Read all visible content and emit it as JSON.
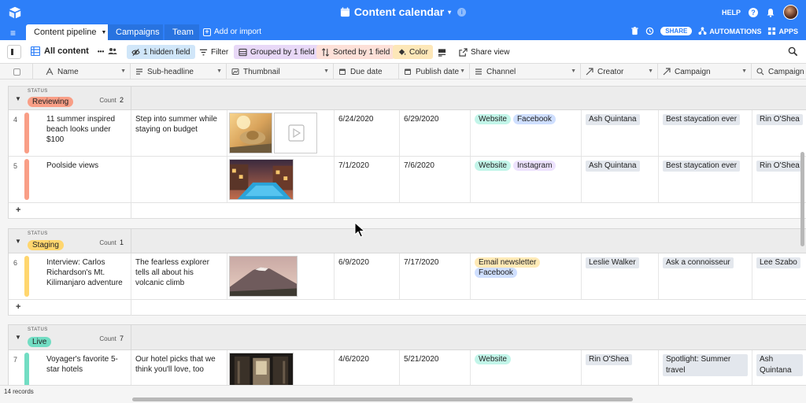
{
  "header": {
    "title": "Content calendar",
    "help": "HELP",
    "title_caret": "▾",
    "info": "i"
  },
  "tabs": [
    {
      "label": "Content pipeline",
      "active": true
    },
    {
      "label": "Campaigns"
    },
    {
      "label": "Team"
    }
  ],
  "tabs_extra": {
    "add_import": "Add or import",
    "share": "SHARE",
    "automations": "AUTOMATIONS",
    "apps": "APPS"
  },
  "toolbar": {
    "view_name": "All content",
    "more": "•••",
    "hidden_fields": "1 hidden field",
    "filter": "Filter",
    "grouped": "Grouped by 1 field",
    "sorted": "Sorted by 1 field",
    "color": "Color",
    "share_view": "Share view"
  },
  "columns": [
    {
      "label": "Name",
      "icon": "text-icon"
    },
    {
      "label": "Sub-headline",
      "icon": "paragraph-icon"
    },
    {
      "label": "Thumbnail",
      "icon": "attachment-icon"
    },
    {
      "label": "Due date",
      "icon": "calendar-icon"
    },
    {
      "label": "Publish date",
      "icon": "calendar-icon"
    },
    {
      "label": "Channel",
      "icon": "multi-select-icon"
    },
    {
      "label": "Creator",
      "icon": "link-icon"
    },
    {
      "label": "Campaign",
      "icon": "link-icon"
    },
    {
      "label": "Campaign lea",
      "icon": "lookup-icon"
    }
  ],
  "groups": [
    {
      "field": "STATUS",
      "value": "Reviewing",
      "color": "#f99e86",
      "count_label": "Count",
      "count": "2",
      "rows": [
        {
          "num": "4",
          "name": "11 summer inspired beach looks under $100",
          "sub": "Step into summer while staying on budget",
          "due": "6/24/2020",
          "publish": "6/29/2020",
          "channels": [
            "Website",
            "Facebook"
          ],
          "creator": "Ash Quintana",
          "campaign": "Best staycation ever",
          "lead": "Rin O'Shea"
        },
        {
          "num": "5",
          "name": "Poolside views",
          "sub": "",
          "due": "7/1/2020",
          "publish": "7/6/2020",
          "channels": [
            "Website",
            "Instagram"
          ],
          "creator": "Ash Quintana",
          "campaign": "Best staycation ever",
          "lead": "Rin O'Shea"
        }
      ]
    },
    {
      "field": "STATUS",
      "value": "Staging",
      "color": "#ffd66e",
      "count_label": "Count",
      "count": "1",
      "rows": [
        {
          "num": "6",
          "name": "Interview: Carlos Richardson's Mt. Kilimanjaro adventure",
          "sub": "The fearless explorer tells all about his volcanic climb",
          "due": "6/9/2020",
          "publish": "7/17/2020",
          "channels": [
            "Email newsletter",
            "Facebook"
          ],
          "creator": "Leslie Walker",
          "campaign": "Ask a connoisseur",
          "lead": "Lee Szabo"
        }
      ]
    },
    {
      "field": "STATUS",
      "value": "Live",
      "color": "#72ddc3",
      "count_label": "Count",
      "count": "7",
      "rows": [
        {
          "num": "7",
          "name": "Voyager's favorite 5-star hotels",
          "sub": "Our hotel picks that we think you'll love, too",
          "due": "4/6/2020",
          "publish": "5/21/2020",
          "channels": [
            "Website"
          ],
          "creator": "Rin O'Shea",
          "campaign": "Spotlight: Summer travel",
          "lead": "Ash Quintana"
        }
      ]
    }
  ],
  "add_row": "+",
  "footer": {
    "records": "14 records"
  },
  "colors": {
    "brand": "#2d7ff9",
    "Website": "#c2f5e9",
    "Facebook": "#cfdfff",
    "Instagram": "#ede2fe",
    "Email newsletter": "#ffeab6"
  }
}
